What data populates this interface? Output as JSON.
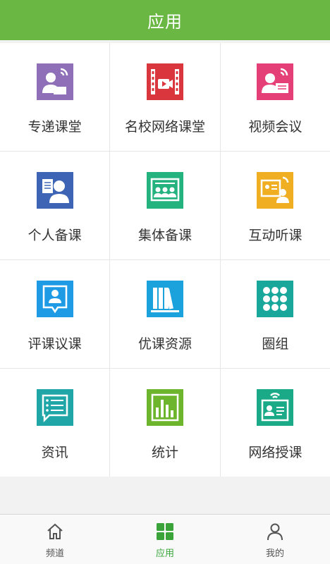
{
  "header": {
    "title": "应用"
  },
  "apps": [
    {
      "label": "专递课堂",
      "icon": "teacher-broadcast-icon",
      "color": "#8e6fb8"
    },
    {
      "label": "名校网络课堂",
      "icon": "video-film-icon",
      "color": "#d9363e"
    },
    {
      "label": "视频会议",
      "icon": "video-conference-icon",
      "color": "#e53f77"
    },
    {
      "label": "个人备课",
      "icon": "personal-lesson-icon",
      "color": "#3e65b5"
    },
    {
      "label": "集体备课",
      "icon": "group-lesson-icon",
      "color": "#24b27f"
    },
    {
      "label": "互动听课",
      "icon": "interactive-lesson-icon",
      "color": "#f0ae22"
    },
    {
      "label": "评课议课",
      "icon": "review-comment-icon",
      "color": "#1f9be6"
    },
    {
      "label": "优课资源",
      "icon": "books-icon",
      "color": "#1ba1dc"
    },
    {
      "label": "圈组",
      "icon": "circle-group-icon",
      "color": "#1aa79b"
    },
    {
      "label": "资讯",
      "icon": "news-icon",
      "color": "#20a6a6"
    },
    {
      "label": "统计",
      "icon": "statistics-icon",
      "color": "#6db52c"
    },
    {
      "label": "网络授课",
      "icon": "online-teaching-icon",
      "color": "#1aaa88"
    }
  ],
  "tabs": [
    {
      "label": "频道",
      "icon": "home-icon",
      "active": false
    },
    {
      "label": "应用",
      "icon": "apps-grid-icon",
      "active": true
    },
    {
      "label": "我的",
      "icon": "user-icon",
      "active": false
    }
  ],
  "colors": {
    "header_bg": "#6ab744",
    "active_tab": "#3aa43a"
  }
}
